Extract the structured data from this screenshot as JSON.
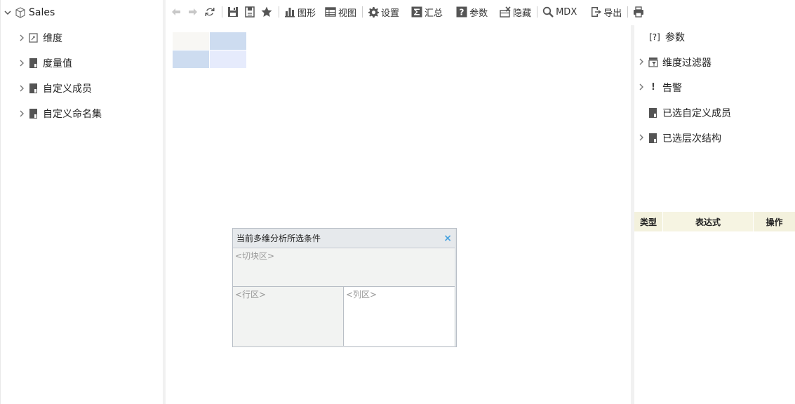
{
  "cube": {
    "name": "Sales"
  },
  "tree": {
    "items": [
      {
        "label": "维度",
        "icon": "dimension-icon"
      },
      {
        "label": "度量值",
        "icon": "measure-icon"
      },
      {
        "label": "自定义成员",
        "icon": "custom-member-icon"
      },
      {
        "label": "自定义命名集",
        "icon": "named-set-icon"
      }
    ]
  },
  "toolbar": {
    "chart_label": "图形",
    "view_label": "视图",
    "settings_label": "设置",
    "summary_label": "汇总",
    "params_label": "参数",
    "hide_label": "隐藏",
    "mdx_label": "MDX",
    "export_label": "导出"
  },
  "grid": {
    "colors": {
      "corner": "#f8f7f4",
      "col_header": "#cddcf0",
      "row_header": "#cddcf0",
      "data": "#e6ebfc"
    }
  },
  "dialog": {
    "title": "当前多维分析所选条件",
    "close": "×",
    "slice_zone": "<切块区>",
    "row_zone": "<行区>",
    "col_zone": "<列区>"
  },
  "right_panel": {
    "items": [
      {
        "label": "参数",
        "icon_text": "[?]",
        "expandable": false
      },
      {
        "label": "维度过滤器",
        "expandable": true
      },
      {
        "label": "告警",
        "icon_text": "!",
        "expandable": true
      },
      {
        "label": "已选自定义成员",
        "expandable": false
      },
      {
        "label": "已选层次结构",
        "expandable": true
      }
    ],
    "table": {
      "col_type": "类型",
      "col_expr": "表达式",
      "col_op": "操作"
    }
  }
}
